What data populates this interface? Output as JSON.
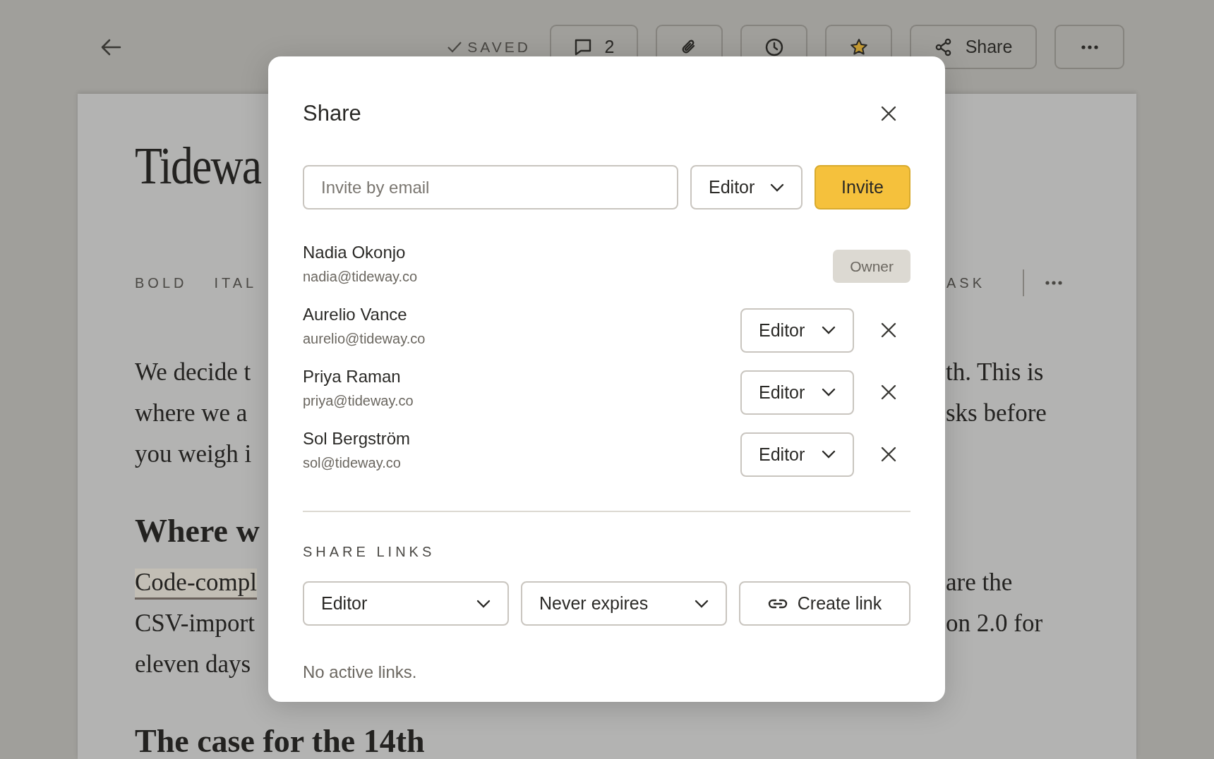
{
  "topbar": {
    "status": "SAVED",
    "comment_count": "2",
    "starred": true,
    "share_label": "Share"
  },
  "document": {
    "title": "Tidewa",
    "toolbar": {
      "left": [
        "BOLD",
        "ITAL"
      ],
      "right": [
        "ASK"
      ]
    },
    "blocks": [
      {
        "kind": "paragraph",
        "lines": [
          {
            "left": "We decide t",
            "right": "th. This is",
            "highlighted": false
          },
          {
            "left": "where we a",
            "right": "sks before",
            "highlighted": false
          },
          {
            "left": "you weigh i",
            "highlighted": false
          }
        ]
      },
      {
        "kind": "heading",
        "text": "Where w"
      },
      {
        "kind": "paragraph",
        "lines": [
          {
            "left": "Code-compl",
            "right": "are the",
            "highlighted": true
          },
          {
            "left": "CSV-import",
            "right": "on 2.0 for",
            "highlighted": false
          },
          {
            "left": "eleven days",
            "highlighted": false
          }
        ]
      },
      {
        "kind": "heading",
        "text": "The case for the 14th"
      }
    ]
  },
  "share_dialog": {
    "title": "Share",
    "invite": {
      "placeholder": "Invite by email",
      "role": "Editor",
      "button": "Invite"
    },
    "members": [
      {
        "name": "Nadia Okonjo",
        "email": "nadia@tideway.co",
        "kind": "owner",
        "role": "Owner"
      },
      {
        "name": "Aurelio Vance",
        "email": "aurelio@tideway.co",
        "kind": "member",
        "role": "Editor"
      },
      {
        "name": "Priya Raman",
        "email": "priya@tideway.co",
        "kind": "member",
        "role": "Editor"
      },
      {
        "name": "Sol Bergström",
        "email": "sol@tideway.co",
        "kind": "member",
        "role": "Editor"
      }
    ],
    "links_heading": "SHARE LINKS",
    "link_role": "Editor",
    "link_expiry": "Never expires",
    "create_button": "Create link",
    "empty_note": "No active links."
  }
}
